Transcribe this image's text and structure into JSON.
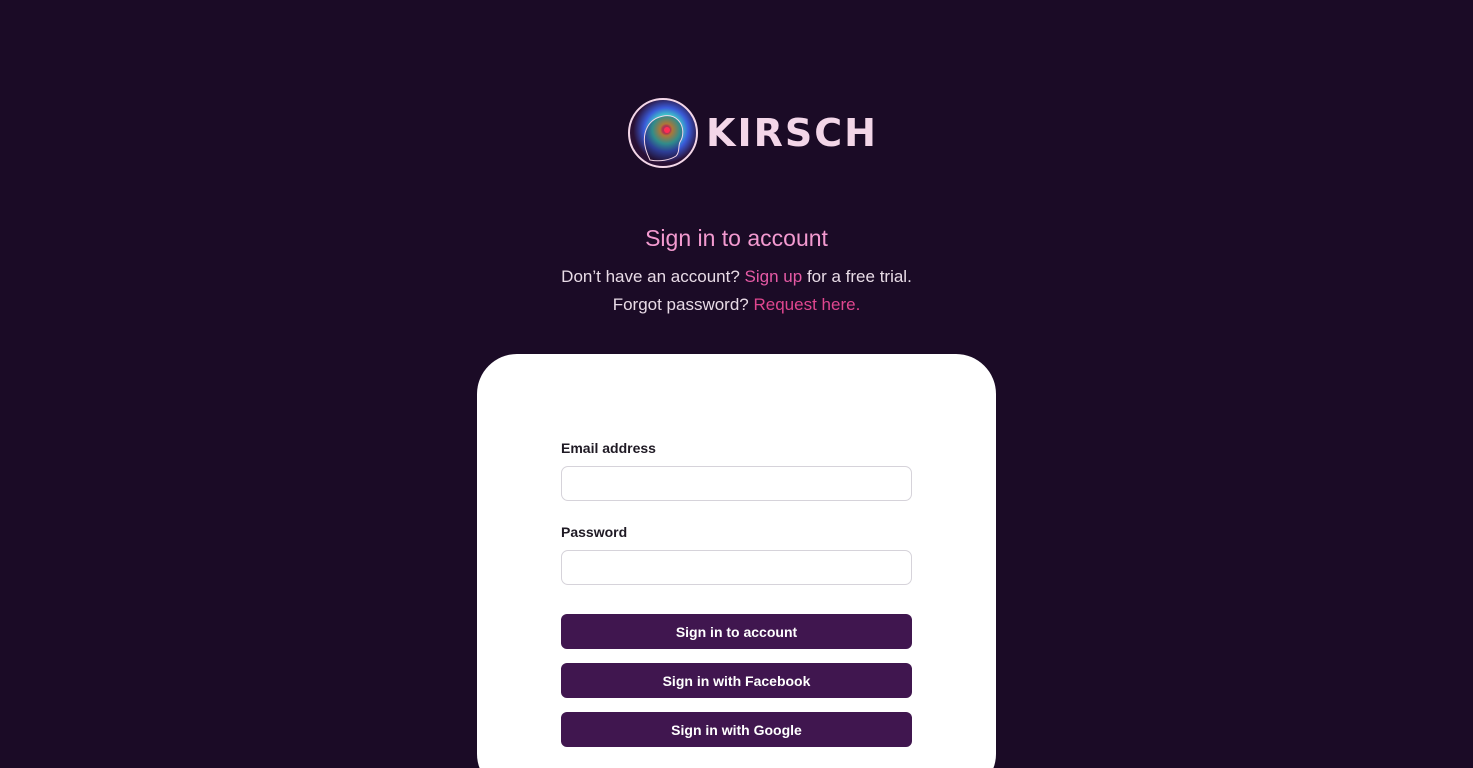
{
  "brand": {
    "name": "KIRSCH",
    "logo_icon": "brain-head-icon",
    "text_color": "#f3d6e8"
  },
  "heading": {
    "title": "Sign in to account",
    "signup_prefix": "Don’t have an account?",
    "signup_link": "Sign up",
    "signup_suffix": "for a free trial.",
    "forgot_prefix": "Forgot password?",
    "forgot_link": "Request here."
  },
  "form": {
    "email_label": "Email address",
    "email_value": "",
    "password_label": "Password",
    "password_value": "",
    "submit_label": "Sign in to account",
    "facebook_label": "Sign in with Facebook",
    "google_label": "Sign in with Google"
  },
  "colors": {
    "background": "#1b0b26",
    "accent_pink": "#f39ad0",
    "link": "#e0468f",
    "button": "#40164f"
  }
}
